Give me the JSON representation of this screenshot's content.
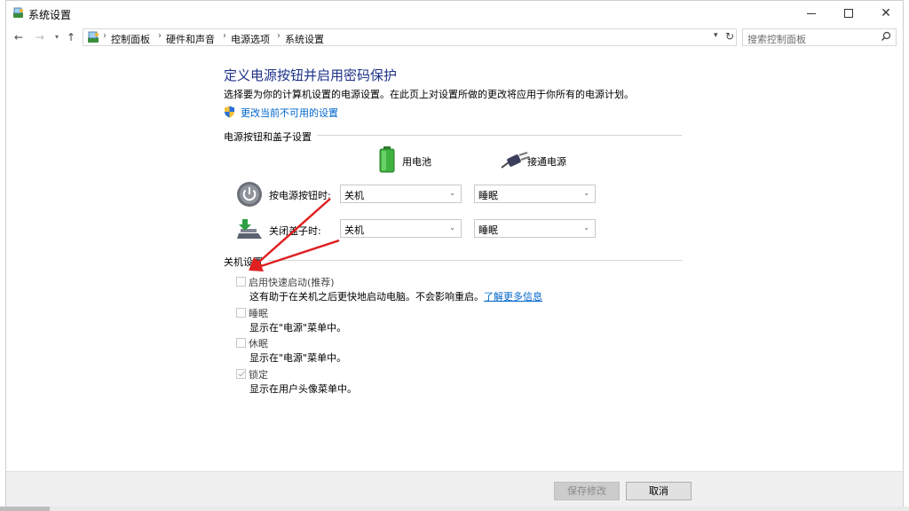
{
  "window": {
    "title": "系统设置"
  },
  "nav": {
    "breadcrumbs": [
      "控制面板",
      "硬件和声音",
      "电源选项",
      "系统设置"
    ],
    "search_placeholder": "搜索控制面板"
  },
  "page": {
    "title": "定义电源按钮并启用密码保护",
    "description": "选择要为你的计算机设置的电源设置。在此页上对设置所做的更改将应用于你所有的电源计划。",
    "change_link": "更改当前不可用的设置"
  },
  "power_section": {
    "label": "电源按钮和盖子设置",
    "col_battery": "用电池",
    "col_plugged": "接通电源",
    "rows": [
      {
        "label": "按电源按钮时:",
        "battery": "关机",
        "plugged": "睡眠"
      },
      {
        "label": "关闭盖子时:",
        "battery": "关机",
        "plugged": "睡眠"
      }
    ]
  },
  "shutdown_section": {
    "label": "关机设置",
    "options": [
      {
        "label": "启用快速启动(推荐)",
        "desc": "这有助于在关机之后更快地启动电脑。不会影响重启。",
        "link": "了解更多信息",
        "checked": false
      },
      {
        "label": "睡眠",
        "desc": "显示在\"电源\"菜单中。",
        "checked": false
      },
      {
        "label": "休眠",
        "desc": "显示在\"电源\"菜单中。",
        "checked": false
      },
      {
        "label": "锁定",
        "desc": "显示在用户头像菜单中。",
        "checked": true
      }
    ]
  },
  "footer": {
    "save": "保存修改",
    "cancel": "取消"
  },
  "colors": {
    "title": "#1e3287",
    "link": "#0066cc",
    "annotation_arrow": "#e02020"
  }
}
